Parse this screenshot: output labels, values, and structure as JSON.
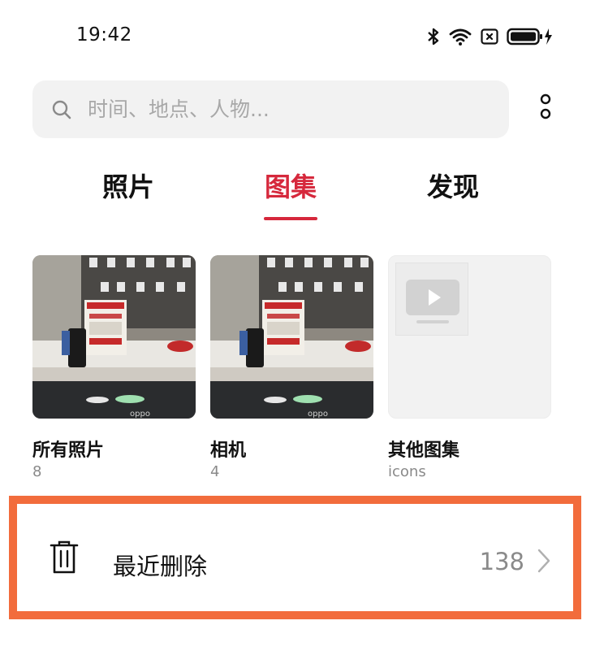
{
  "status_bar": {
    "time": "19:42",
    "icons": [
      "bluetooth-icon",
      "wifi-icon",
      "sim-disabled-icon",
      "battery-charging-icon"
    ]
  },
  "search": {
    "placeholder": "时间、地点、人物...",
    "icon": "search-icon"
  },
  "more_menu_icon": "more-vertical-icon",
  "tabs": [
    {
      "label": "照片",
      "active": false
    },
    {
      "label": "图集",
      "active": true
    },
    {
      "label": "发现",
      "active": false
    }
  ],
  "albums": [
    {
      "title": "所有照片",
      "count": "8"
    },
    {
      "title": "相机",
      "count": "4"
    },
    {
      "title": "其他图集",
      "count": "icons"
    }
  ],
  "recently_deleted": {
    "icon": "trash-icon",
    "label": "最近删除",
    "count": "138"
  },
  "colors": {
    "accent": "#d6283c",
    "highlight_outline": "#f26c3c",
    "search_bg": "#f2f2f2",
    "muted_text": "#8a8a8a"
  }
}
